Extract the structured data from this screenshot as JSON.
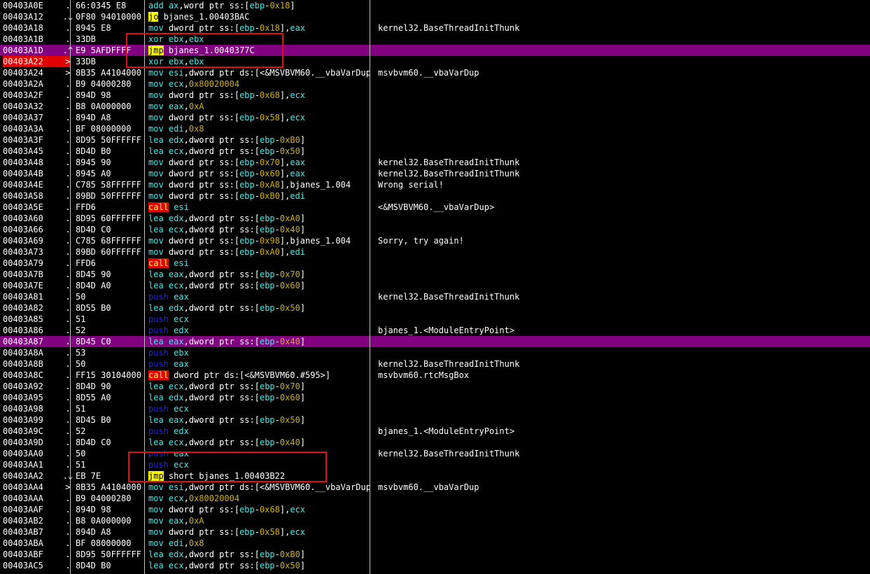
{
  "colors": {
    "background": "#000000",
    "mnemonic": "#3cf0f0",
    "push": "#2020ff",
    "call_bg": "#e00000",
    "jmp_bg": "#ffff00",
    "highlight": "#800080",
    "annotation_box": "#e01010"
  },
  "rows": [
    {
      "addr": "00403A0E",
      "mark": ".",
      "hex": "66:0345 E8",
      "mn": "add",
      "op": "ax,word ptr ss:[ebp-0x18]",
      "cmt": ""
    },
    {
      "addr": "00403A12",
      "mark": ".⌄",
      "hex": "0F80 94010000",
      "mn": "jo",
      "op": "bjanes_1.00403BAC",
      "cmt": "",
      "kind": "jmp"
    },
    {
      "addr": "00403A18",
      "mark": ".",
      "hex": "8945 E8",
      "mn": "mov",
      "op": "dword ptr ss:[ebp-0x18],eax",
      "cmt": "kernel32.BaseThreadInitThunk"
    },
    {
      "addr": "00403A1B",
      "mark": ".",
      "hex": "33DB",
      "mn": "xor",
      "op": "ebx,ebx",
      "cmt": ""
    },
    {
      "addr": "00403A1D",
      "mark": ".^",
      "hex": "E9 5AFDFFFF",
      "mn": "jmp",
      "op": "bjanes_1.0040377C",
      "cmt": "",
      "kind": "jmp",
      "hl": true
    },
    {
      "addr": "00403A22",
      "mark": ">",
      "hex": "33DB",
      "mn": "xor",
      "op": "ebx,ebx",
      "cmt": "",
      "cur": true
    },
    {
      "addr": "00403A24",
      "mark": ">",
      "hex": "8B35 A4104000",
      "mn": "mov",
      "op": "esi,dword ptr ds:[<&MSVBVM60.__vbaVarDup>]",
      "cmt": "msvbvm60.__vbaVarDup"
    },
    {
      "addr": "00403A2A",
      "mark": ".",
      "hex": "B9 04000280",
      "mn": "mov",
      "op": "ecx,0x80020004",
      "cmt": ""
    },
    {
      "addr": "00403A2F",
      "mark": ".",
      "hex": "894D 98",
      "mn": "mov",
      "op": "dword ptr ss:[ebp-0x68],ecx",
      "cmt": ""
    },
    {
      "addr": "00403A32",
      "mark": ".",
      "hex": "B8 0A000000",
      "mn": "mov",
      "op": "eax,0xA",
      "cmt": ""
    },
    {
      "addr": "00403A37",
      "mark": ".",
      "hex": "894D A8",
      "mn": "mov",
      "op": "dword ptr ss:[ebp-0x58],ecx",
      "cmt": ""
    },
    {
      "addr": "00403A3A",
      "mark": ".",
      "hex": "BF 08000000",
      "mn": "mov",
      "op": "edi,0x8",
      "cmt": ""
    },
    {
      "addr": "00403A3F",
      "mark": ".",
      "hex": "8D95 50FFFFFF",
      "mn": "lea",
      "op": "edx,dword ptr ss:[ebp-0xB0]",
      "cmt": ""
    },
    {
      "addr": "00403A45",
      "mark": ".",
      "hex": "8D4D B0",
      "mn": "lea",
      "op": "ecx,dword ptr ss:[ebp-0x50]",
      "cmt": ""
    },
    {
      "addr": "00403A48",
      "mark": ".",
      "hex": "8945 90",
      "mn": "mov",
      "op": "dword ptr ss:[ebp-0x70],eax",
      "cmt": "kernel32.BaseThreadInitThunk"
    },
    {
      "addr": "00403A4B",
      "mark": ".",
      "hex": "8945 A0",
      "mn": "mov",
      "op": "dword ptr ss:[ebp-0x60],eax",
      "cmt": "kernel32.BaseThreadInitThunk"
    },
    {
      "addr": "00403A4E",
      "mark": ".",
      "hex": "C785 58FFFFFF",
      "mn": "mov",
      "op": "dword ptr ss:[ebp-0xA8],bjanes_1.004",
      "cmt": "Wrong serial!"
    },
    {
      "addr": "00403A58",
      "mark": ".",
      "hex": "89BD 50FFFFFF",
      "mn": "mov",
      "op": "dword ptr ss:[ebp-0xB0],edi",
      "cmt": ""
    },
    {
      "addr": "00403A5E",
      "mark": ".",
      "hex": "FFD6",
      "mn": "call",
      "op": "esi",
      "cmt": "<&MSVBVM60.__vbaVarDup>",
      "kind": "call"
    },
    {
      "addr": "00403A60",
      "mark": ".",
      "hex": "8D95 60FFFFFF",
      "mn": "lea",
      "op": "edx,dword ptr ss:[ebp-0xA0]",
      "cmt": ""
    },
    {
      "addr": "00403A66",
      "mark": ".",
      "hex": "8D4D C0",
      "mn": "lea",
      "op": "ecx,dword ptr ss:[ebp-0x40]",
      "cmt": ""
    },
    {
      "addr": "00403A69",
      "mark": ".",
      "hex": "C785 68FFFFFF",
      "mn": "mov",
      "op": "dword ptr ss:[ebp-0x98],bjanes_1.004",
      "cmt": "Sorry, try again!"
    },
    {
      "addr": "00403A73",
      "mark": ".",
      "hex": "89BD 60FFFFFF",
      "mn": "mov",
      "op": "dword ptr ss:[ebp-0xA0],edi",
      "cmt": ""
    },
    {
      "addr": "00403A79",
      "mark": ".",
      "hex": "FFD6",
      "mn": "call",
      "op": "esi",
      "cmt": "",
      "kind": "call"
    },
    {
      "addr": "00403A7B",
      "mark": ".",
      "hex": "8D45 90",
      "mn": "lea",
      "op": "eax,dword ptr ss:[ebp-0x70]",
      "cmt": ""
    },
    {
      "addr": "00403A7E",
      "mark": ".",
      "hex": "8D4D A0",
      "mn": "lea",
      "op": "ecx,dword ptr ss:[ebp-0x60]",
      "cmt": ""
    },
    {
      "addr": "00403A81",
      "mark": ".",
      "hex": "50",
      "mn": "push",
      "op": "eax",
      "cmt": "kernel32.BaseThreadInitThunk",
      "kind": "push"
    },
    {
      "addr": "00403A82",
      "mark": ".",
      "hex": "8D55 B0",
      "mn": "lea",
      "op": "edx,dword ptr ss:[ebp-0x50]",
      "cmt": ""
    },
    {
      "addr": "00403A85",
      "mark": ".",
      "hex": "51",
      "mn": "push",
      "op": "ecx",
      "cmt": "",
      "kind": "push"
    },
    {
      "addr": "00403A86",
      "mark": ".",
      "hex": "52",
      "mn": "push",
      "op": "edx",
      "cmt": "bjanes_1.<ModuleEntryPoint>",
      "kind": "push"
    },
    {
      "addr": "00403A87",
      "mark": ".",
      "hex": "8D45 C0",
      "mn": "lea",
      "op": "eax,dword ptr ss:[ebp-0x40]",
      "cmt": "",
      "hl": true
    },
    {
      "addr": "00403A8A",
      "mark": ".",
      "hex": "53",
      "mn": "push",
      "op": "ebx",
      "cmt": "",
      "kind": "push"
    },
    {
      "addr": "00403A8B",
      "mark": ".",
      "hex": "50",
      "mn": "push",
      "op": "eax",
      "cmt": "kernel32.BaseThreadInitThunk",
      "kind": "push"
    },
    {
      "addr": "00403A8C",
      "mark": ".",
      "hex": "FF15 30104000",
      "mn": "call",
      "op": "dword ptr ds:[<&MSVBVM60.#595>]",
      "cmt": "msvbvm60.rtcMsgBox",
      "kind": "call"
    },
    {
      "addr": "00403A92",
      "mark": ".",
      "hex": "8D4D 90",
      "mn": "lea",
      "op": "ecx,dword ptr ss:[ebp-0x70]",
      "cmt": ""
    },
    {
      "addr": "00403A95",
      "mark": ".",
      "hex": "8D55 A0",
      "mn": "lea",
      "op": "edx,dword ptr ss:[ebp-0x60]",
      "cmt": ""
    },
    {
      "addr": "00403A98",
      "mark": ".",
      "hex": "51",
      "mn": "push",
      "op": "ecx",
      "cmt": "",
      "kind": "push"
    },
    {
      "addr": "00403A99",
      "mark": ".",
      "hex": "8D45 B0",
      "mn": "lea",
      "op": "eax,dword ptr ss:[ebp-0x50]",
      "cmt": ""
    },
    {
      "addr": "00403A9C",
      "mark": ".",
      "hex": "52",
      "mn": "push",
      "op": "edx",
      "cmt": "bjanes_1.<ModuleEntryPoint>",
      "kind": "push"
    },
    {
      "addr": "00403A9D",
      "mark": ".",
      "hex": "8D4D C0",
      "mn": "lea",
      "op": "ecx,dword ptr ss:[ebp-0x40]",
      "cmt": ""
    },
    {
      "addr": "00403AA0",
      "mark": ".",
      "hex": "50",
      "mn": "push",
      "op": "eax",
      "cmt": "kernel32.BaseThreadInitThunk",
      "kind": "push"
    },
    {
      "addr": "00403AA1",
      "mark": ".",
      "hex": "51",
      "mn": "push",
      "op": "ecx",
      "cmt": "",
      "kind": "push"
    },
    {
      "addr": "00403AA2",
      "mark": ".⌄",
      "hex": "EB 7E",
      "mn": "jmp",
      "op": "short bjanes_1.00403B22",
      "cmt": "",
      "kind": "jmp"
    },
    {
      "addr": "00403AA4",
      "mark": ">",
      "hex": "8B35 A4104000",
      "mn": "mov",
      "op": "esi,dword ptr ds:[<&MSVBVM60.__vbaVarDup>]",
      "cmt": "msvbvm60.__vbaVarDup"
    },
    {
      "addr": "00403AAA",
      "mark": ".",
      "hex": "B9 04000280",
      "mn": "mov",
      "op": "ecx,0x80020004",
      "cmt": ""
    },
    {
      "addr": "00403AAF",
      "mark": ".",
      "hex": "894D 98",
      "mn": "mov",
      "op": "dword ptr ss:[ebp-0x68],ecx",
      "cmt": ""
    },
    {
      "addr": "00403AB2",
      "mark": ".",
      "hex": "B8 0A000000",
      "mn": "mov",
      "op": "eax,0xA",
      "cmt": ""
    },
    {
      "addr": "00403AB7",
      "mark": ".",
      "hex": "894D A8",
      "mn": "mov",
      "op": "dword ptr ss:[ebp-0x58],ecx",
      "cmt": ""
    },
    {
      "addr": "00403ABA",
      "mark": ".",
      "hex": "BF 08000000",
      "mn": "mov",
      "op": "edi,0x8",
      "cmt": ""
    },
    {
      "addr": "00403ABF",
      "mark": ".",
      "hex": "8D95 50FFFFFF",
      "mn": "lea",
      "op": "edx,dword ptr ss:[ebp-0xB0]",
      "cmt": ""
    },
    {
      "addr": "00403AC5",
      "mark": ".",
      "hex": "8D4D B0",
      "mn": "lea",
      "op": "ecx,dword ptr ss:[ebp-0x50]",
      "cmt": ""
    }
  ]
}
